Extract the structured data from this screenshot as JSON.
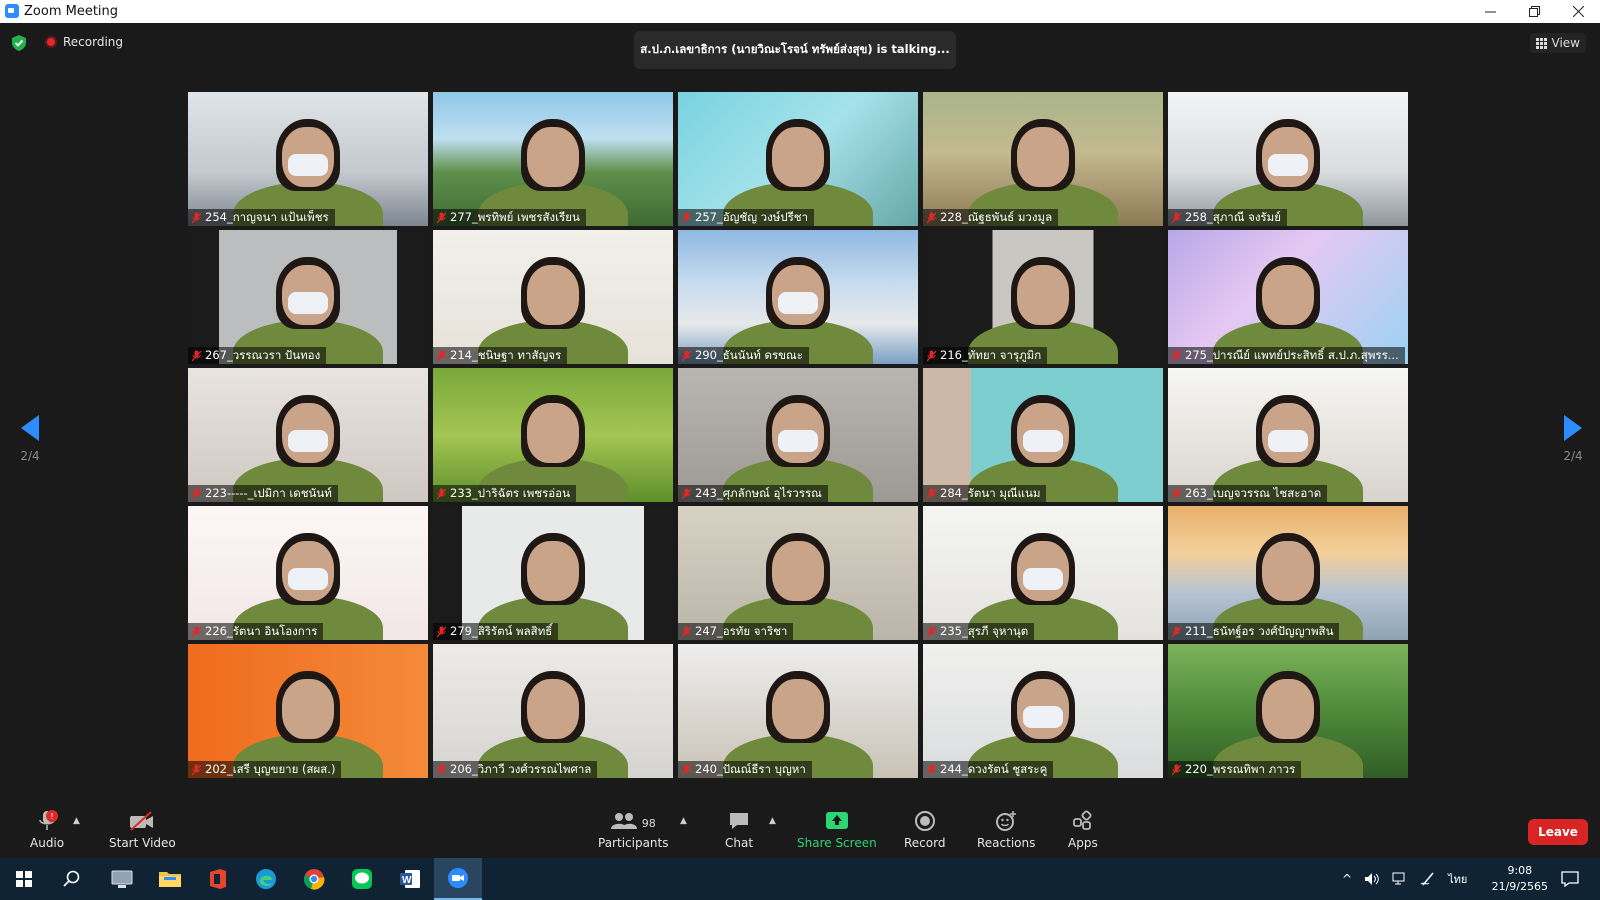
{
  "window": {
    "title": "Zoom Meeting",
    "minimize_icon": "minimize-icon",
    "restore_icon": "restore-icon",
    "close_icon": "close-icon"
  },
  "meeting": {
    "recording_label": "Recording",
    "talking_banner": "ส.ป.ภ.เลขาธิการ (นายวิณะโรจน์ ทรัพย์ส่งสุข) is  talking...",
    "view_label": "View",
    "page_indicator_left": "2/4",
    "page_indicator_right": "2/4"
  },
  "participants": [
    {
      "name": "254_กาญจนา แป้นเพ็ชร"
    },
    {
      "name": "277_พรทิพย์ เพชรสังเรียน"
    },
    {
      "name": "257_อัญชัญ วงษ์ปรีชา"
    },
    {
      "name": "228_ณัฐธพันธ์ มวงมูล"
    },
    {
      "name": "258_สุภาณี จงรัมย์"
    },
    {
      "name": "267_วรรณวรา ปันทอง"
    },
    {
      "name": "214_ชนิษฐา ทาสัญจร"
    },
    {
      "name": "290_ธันนันท์ ดรขณะ"
    },
    {
      "name": "216_ทัทยา จารุภูมิก"
    },
    {
      "name": "275_ปารณีย์ แพทย์ประสิทธิ์ ส.ป.ภ.สุพรร..."
    },
    {
      "name": "223-----_เปมิกา เดชนันท์"
    },
    {
      "name": "233_ปาริฉัตร เพชรอ่อน"
    },
    {
      "name": "243_ศุภลักษณ์ อุไรวรรณ"
    },
    {
      "name": "284_รัตนา มุณีแนม"
    },
    {
      "name": "263_เบญจวรรณ ไชสะอาด"
    },
    {
      "name": "226_รัตนา  อินโองการ"
    },
    {
      "name": "279_สิริรัตน์ พลสิทธิ์"
    },
    {
      "name": "247_อรทัย จาริชา"
    },
    {
      "name": "235_สุรภี  จุหานุต"
    },
    {
      "name": "211_ธนัทฐ์อร วงศ์ปัญญาพสิน"
    },
    {
      "name": "202_เสรี บุญขยาย (สผส.)"
    },
    {
      "name": "206_วิภาวี วงศ์วรรณไพศาล"
    },
    {
      "name": "240_ปัณณ์ธีรา บุญหา"
    },
    {
      "name": "244_ดวงรัตน์ ชูสระคู"
    },
    {
      "name": "220_พรรณทิพา ภาวร"
    }
  ],
  "toolbar": {
    "audio_label": "Audio",
    "audio_badge": "!",
    "start_video_label": "Start Video",
    "participants_label": "Participants",
    "participants_count": "98",
    "chat_label": "Chat",
    "share_screen_label": "Share Screen",
    "record_label": "Record",
    "reactions_label": "Reactions",
    "apps_label": "Apps",
    "leave_label": "Leave"
  },
  "taskbar": {
    "language": "ไทย",
    "time": "9:08",
    "date": "21/9/2565"
  },
  "colors": {
    "accent": "#2d8cff",
    "share": "#2ed573",
    "leave": "#d72525",
    "recording": "#e02828"
  }
}
